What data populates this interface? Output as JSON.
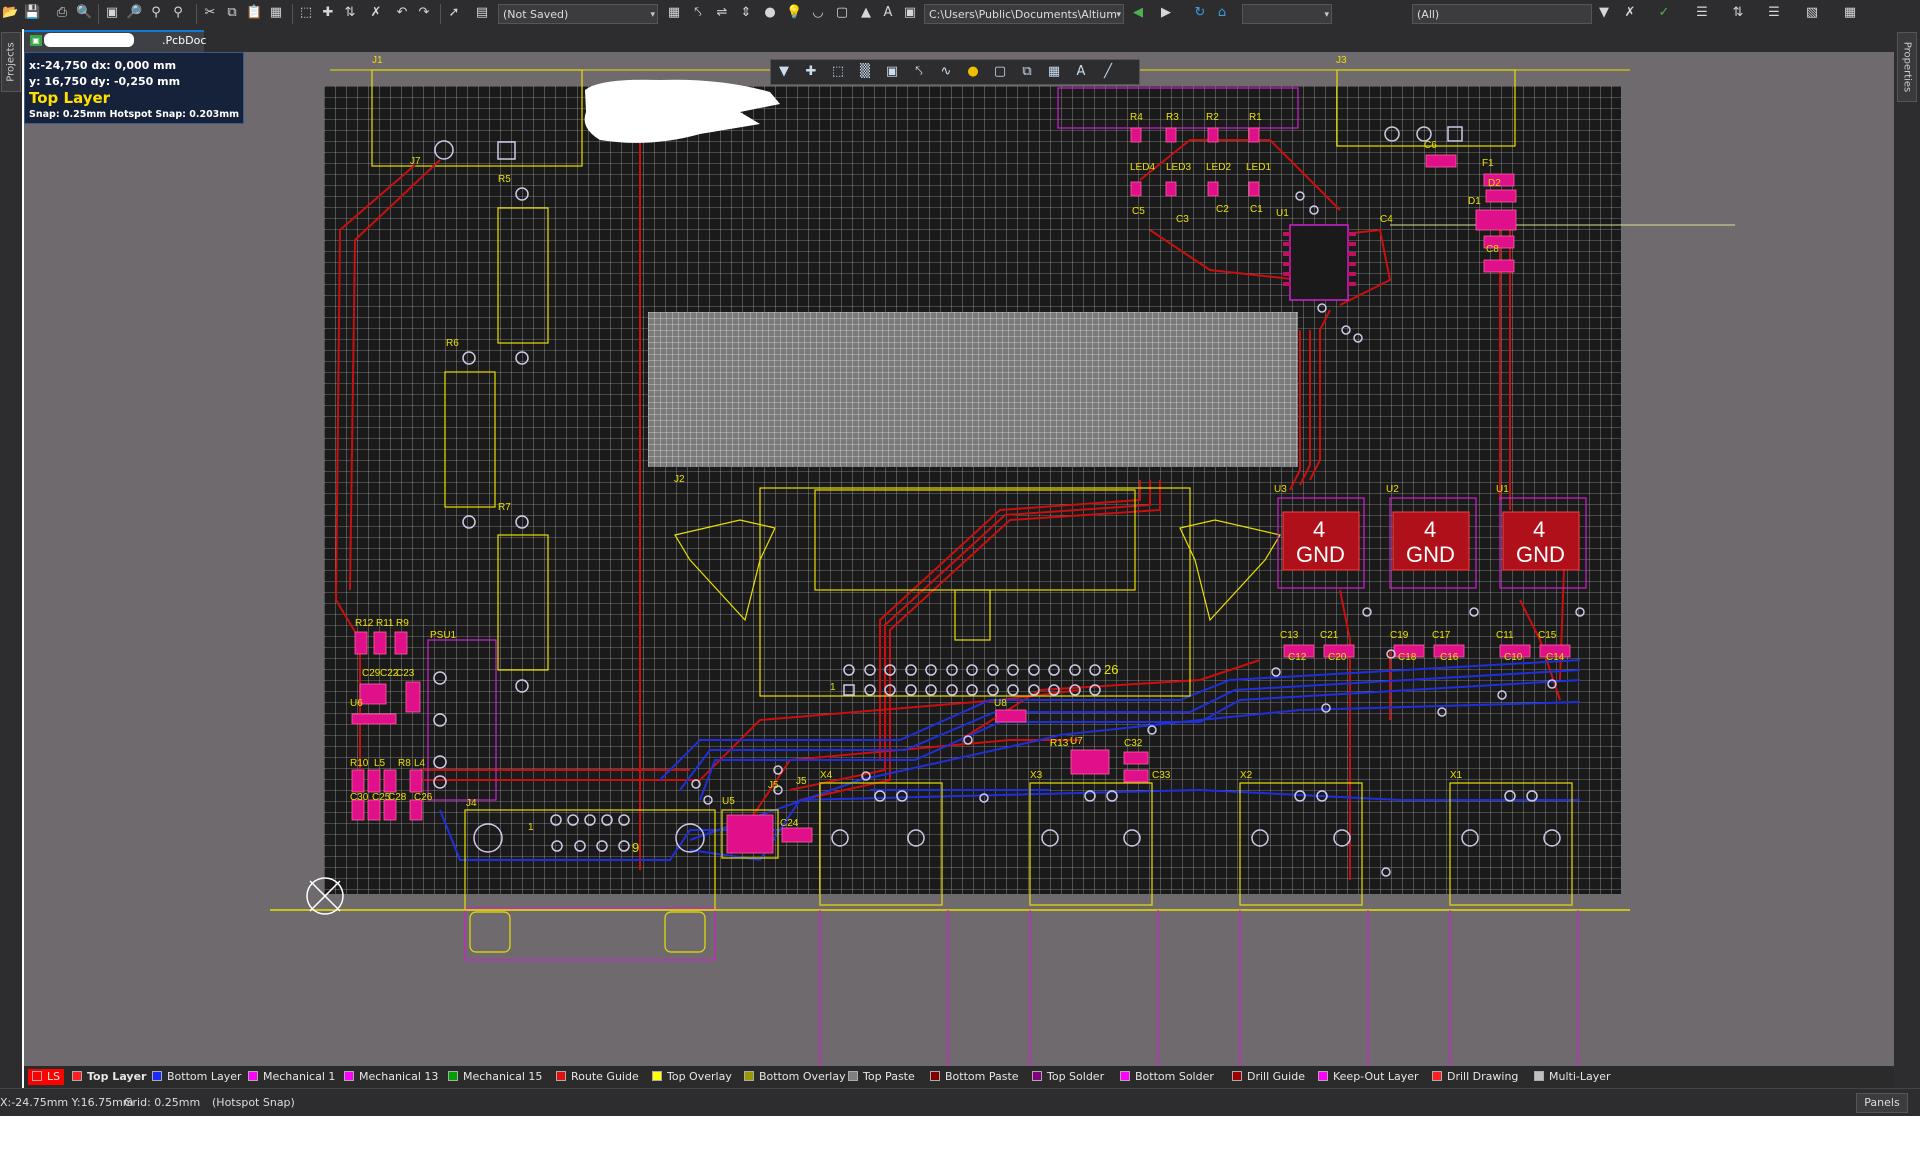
{
  "toolbar": {
    "save_status": "(Not Saved)",
    "path": "C:\\Users\\Public\\Documents\\Altium",
    "filter_all": "(All)"
  },
  "document": {
    "tab_name": ".PcbDoc"
  },
  "side": {
    "left_tab": "Projects",
    "right_tab": "Properties"
  },
  "hud": {
    "line1": "x:-24,750   dx:  0,000 mm",
    "line2": "y: 16,750   dy: -0,250 mm",
    "layer": "Top Layer",
    "snap": "Snap: 0.25mm Hotspot Snap: 0.203mm"
  },
  "pcb": {
    "designators": {
      "J1": "J1",
      "J2": "J2",
      "J3": "J3",
      "J4": "J4",
      "J5": "J5",
      "J7": "J7",
      "R1": "R1",
      "R2": "R2",
      "R3": "R3",
      "R4": "R4",
      "R5": "R5",
      "R6": "R6",
      "R7": "R7",
      "R8": "R8",
      "R9": "R9",
      "R10": "R10",
      "R11": "R11",
      "R12": "R12",
      "R13": "R13",
      "LED1": "LED1",
      "LED2": "LED2",
      "LED3": "LED3",
      "LED4": "LED4",
      "C1": "C1",
      "C2": "C2",
      "C3": "C3",
      "C4": "C4",
      "C5": "C5",
      "C6": "C6",
      "C8": "C8",
      "C10": "C10",
      "C11": "C11",
      "C12": "C12",
      "C13": "C13",
      "C14": "C14",
      "C15": "C15",
      "C16": "C16",
      "C17": "C17",
      "C18": "C18",
      "C19": "C19",
      "C20": "C20",
      "C21": "C21",
      "C22": "C22",
      "C23": "C23",
      "C24": "C24",
      "C25": "C25",
      "C26": "C26",
      "C28": "C28",
      "C29": "C29",
      "C30": "C30",
      "C32": "C32",
      "C33": "C33",
      "U1": "U1",
      "U2": "U2",
      "U3": "U3",
      "U5": "U5",
      "U6": "U6",
      "U7": "U7",
      "U8": "U8",
      "PSU1": "PSU1",
      "F1": "F1",
      "D1": "D1",
      "D2": "D2",
      "L4": "L4",
      "L5": "L5",
      "X1": "X1",
      "X2": "X2",
      "X3": "X3",
      "X4": "X4",
      "pin1": "1",
      "pin26": "26",
      "pin9": "9"
    },
    "regulator_pin": "4",
    "regulator_label": "GND"
  },
  "layers": [
    {
      "name": "LS",
      "color": "#ff0000"
    },
    {
      "name": "Top Layer",
      "color": "#ff2020"
    },
    {
      "name": "Bottom Layer",
      "color": "#1c2bff"
    },
    {
      "name": "Mechanical 1",
      "color": "#ff00ff"
    },
    {
      "name": "Mechanical 13",
      "color": "#ff00ff"
    },
    {
      "name": "Mechanical 15",
      "color": "#00a000"
    },
    {
      "name": "Route Guide",
      "color": "#e01010"
    },
    {
      "name": "Top Overlay",
      "color": "#ffff00"
    },
    {
      "name": "Bottom Overlay",
      "color": "#9a9a00"
    },
    {
      "name": "Top Paste",
      "color": "#808080"
    },
    {
      "name": "Bottom Paste",
      "color": "#800000"
    },
    {
      "name": "Top Solder",
      "color": "#800080"
    },
    {
      "name": "Bottom Solder",
      "color": "#ff00ff"
    },
    {
      "name": "Drill Guide",
      "color": "#a00000"
    },
    {
      "name": "Keep-Out Layer",
      "color": "#ff00ff"
    },
    {
      "name": "Drill Drawing",
      "color": "#ff2020"
    },
    {
      "name": "Multi-Layer",
      "color": "#c0c0c0"
    }
  ],
  "status": {
    "coords": "X:-24.75mm Y:16.75mm",
    "grid": "Grid: 0.25mm",
    "snap": "(Hotspot Snap)",
    "panels": "Panels"
  }
}
